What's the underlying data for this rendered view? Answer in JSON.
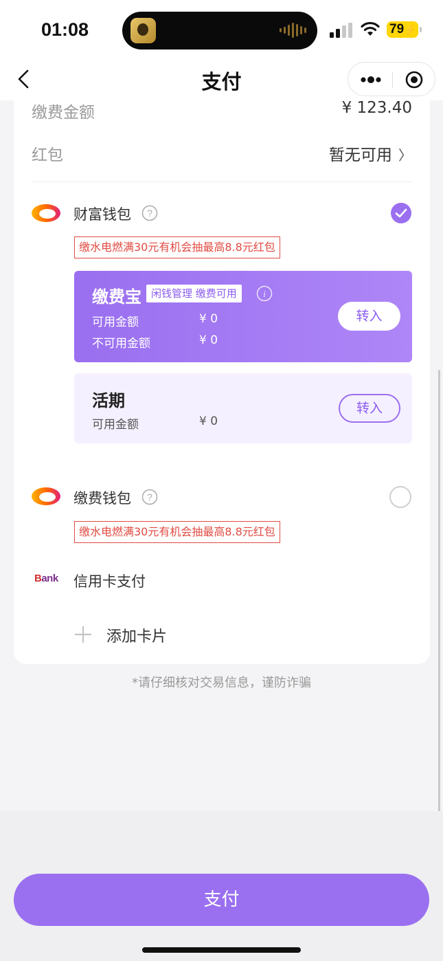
{
  "status_bar": {
    "time": "01:08",
    "battery": "79"
  },
  "nav": {
    "title": "支付"
  },
  "summary": {
    "amount_label": "缴费金额",
    "amount_value": "¥ 123.40",
    "redpacket_label": "红包",
    "redpacket_value": "暂无可用",
    "redpacket_chevron": "〉"
  },
  "wallets": [
    {
      "name": "财富钱包",
      "promo": "缴水电燃满30元有机会抽最高8.8元红包",
      "selected": true,
      "jiaofeibao": {
        "title": "缴费宝",
        "tag": "闲钱管理 缴费可用",
        "available_label": "可用金额",
        "available_value": "¥ 0",
        "unavailable_label": "不可用金额",
        "unavailable_value": "¥ 0",
        "transfer_label": "转入"
      },
      "huoqi": {
        "title": "活期",
        "available_label": "可用金额",
        "available_value": "¥ 0",
        "transfer_label": "转入"
      }
    },
    {
      "name": "缴费钱包",
      "promo": "缴水电燃满30元有机会抽最高8.8元红包",
      "selected": false
    }
  ],
  "credit_card": {
    "logo_b": "B",
    "logo_rest": "ank",
    "label": "信用卡支付"
  },
  "add_card": {
    "label": "添加卡片"
  },
  "footer_note": "*请仔细核对交易信息，谨防诈骗",
  "pay_button": "支付",
  "colors": {
    "accent": "#9a6ff0",
    "promo_red": "#e14b43",
    "battery": "#ffd60a"
  }
}
